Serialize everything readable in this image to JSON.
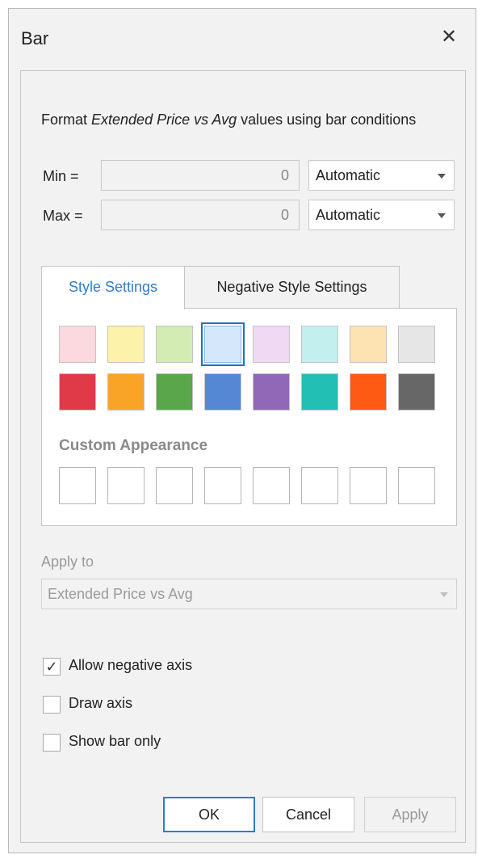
{
  "window": {
    "title": "Bar"
  },
  "description": {
    "prefix": "Format ",
    "field": "Extended Price vs Avg",
    "suffix": " values using bar conditions"
  },
  "min": {
    "label": "Min =",
    "value": "0",
    "mode": "Automatic"
  },
  "max": {
    "label": "Max =",
    "value": "0",
    "mode": "Automatic"
  },
  "tabs": [
    {
      "label": "Style Settings",
      "active": true
    },
    {
      "label": "Negative Style Settings",
      "active": false
    }
  ],
  "swatches": {
    "light": [
      "#fbd9de",
      "#fdf2a9",
      "#d2ecb3",
      "#d5e8fb",
      "#f0d9f3",
      "#c3f0ee",
      "#fde2b2",
      "#e6e6e6"
    ],
    "dark": [
      "#e03a48",
      "#f9a426",
      "#5aa64b",
      "#5588d4",
      "#9168b8",
      "#22bfb4",
      "#ff5a13",
      "#676767"
    ],
    "selected_index": 3
  },
  "custom": {
    "title": "Custom Appearance",
    "count": 8
  },
  "apply_to": {
    "label": "Apply to",
    "value": "Extended Price vs Avg"
  },
  "options": [
    {
      "label": "Allow negative axis",
      "checked": true
    },
    {
      "label": "Draw axis",
      "checked": false
    },
    {
      "label": "Show bar only",
      "checked": false
    }
  ],
  "buttons": {
    "ok": "OK",
    "cancel": "Cancel",
    "apply": "Apply"
  },
  "icons": {
    "close": "close-icon",
    "check": "check-icon",
    "dropdown": "chevron-down-icon"
  }
}
